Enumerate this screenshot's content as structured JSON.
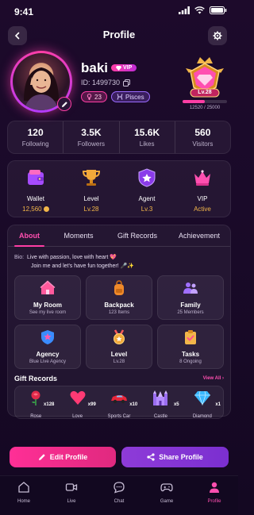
{
  "status_bar": {
    "time": "9:41"
  },
  "header": {
    "title": "Profile"
  },
  "profile": {
    "name": "baki",
    "vip_badge": "VIP",
    "id_text": "ID: 1499730",
    "gender_age": "23",
    "zodiac": "Pisces",
    "level_label": "Lv.28",
    "level_progress_text": "12520 / 25000",
    "level_progress": 0.5008
  },
  "stats": [
    {
      "value": "120",
      "label": "Following"
    },
    {
      "value": "3.5K",
      "label": "Followers"
    },
    {
      "value": "15.6K",
      "label": "Likes"
    },
    {
      "value": "560",
      "label": "Visitors"
    }
  ],
  "quick_actions": [
    {
      "label": "Wallet",
      "value": "12,560",
      "icon": "wallet-icon"
    },
    {
      "label": "Level",
      "value": "Lv.28",
      "icon": "trophy-icon"
    },
    {
      "label": "Agent",
      "value": "Lv.3",
      "icon": "shield-icon"
    },
    {
      "label": "VIP",
      "value": "Active",
      "icon": "crown-icon"
    }
  ],
  "tabs": [
    {
      "label": "About",
      "active": true
    },
    {
      "label": "Moments",
      "active": false
    },
    {
      "label": "Gift Records",
      "active": false
    },
    {
      "label": "Achievement",
      "active": false
    }
  ],
  "bio": {
    "label": "Bio:",
    "line1": "Live with passion, love with heart 💖",
    "line2": "Join me and let's have fun together! 🎤✨"
  },
  "features": [
    {
      "title": "My Room",
      "subtitle": "See my live room",
      "icon": "house-icon"
    },
    {
      "title": "Backpack",
      "subtitle": "123 Items",
      "icon": "backpack-icon"
    },
    {
      "title": "Family",
      "subtitle": "25 Members",
      "icon": "family-icon"
    },
    {
      "title": "Agency",
      "subtitle": "Blue Live Agency",
      "icon": "agency-shield-icon"
    },
    {
      "title": "Level",
      "subtitle": "Lv.28",
      "icon": "medal-icon"
    },
    {
      "title": "Tasks",
      "subtitle": "8 Ongoing",
      "icon": "clipboard-icon"
    }
  ],
  "gift_records": {
    "title": "Gift Records",
    "view_all": "View All",
    "items": [
      {
        "name": "Rose",
        "count": "x128",
        "icon": "rose-icon"
      },
      {
        "name": "Love",
        "count": "x99",
        "icon": "heart-icon"
      },
      {
        "name": "Sports Car",
        "count": "x10",
        "icon": "car-icon"
      },
      {
        "name": "Castle",
        "count": "x5",
        "icon": "castle-icon"
      },
      {
        "name": "Diamond",
        "count": "x1",
        "icon": "diamond-icon"
      }
    ]
  },
  "actions": {
    "edit_label": "Edit Profile",
    "share_label": "Share Profile"
  },
  "bottom_nav": [
    {
      "label": "Home",
      "icon": "home-icon",
      "active": false
    },
    {
      "label": "Live",
      "icon": "live-icon",
      "active": false
    },
    {
      "label": "Chat",
      "icon": "chat-icon",
      "active": false
    },
    {
      "label": "Game",
      "icon": "gamepad-icon",
      "active": false
    },
    {
      "label": "Profile",
      "icon": "profile-icon",
      "active": true
    }
  ],
  "colors": {
    "accent": "#ff3ea5",
    "gold": "#f2b64a",
    "purple": "#8e3bd8",
    "background": "#1a0a29"
  }
}
